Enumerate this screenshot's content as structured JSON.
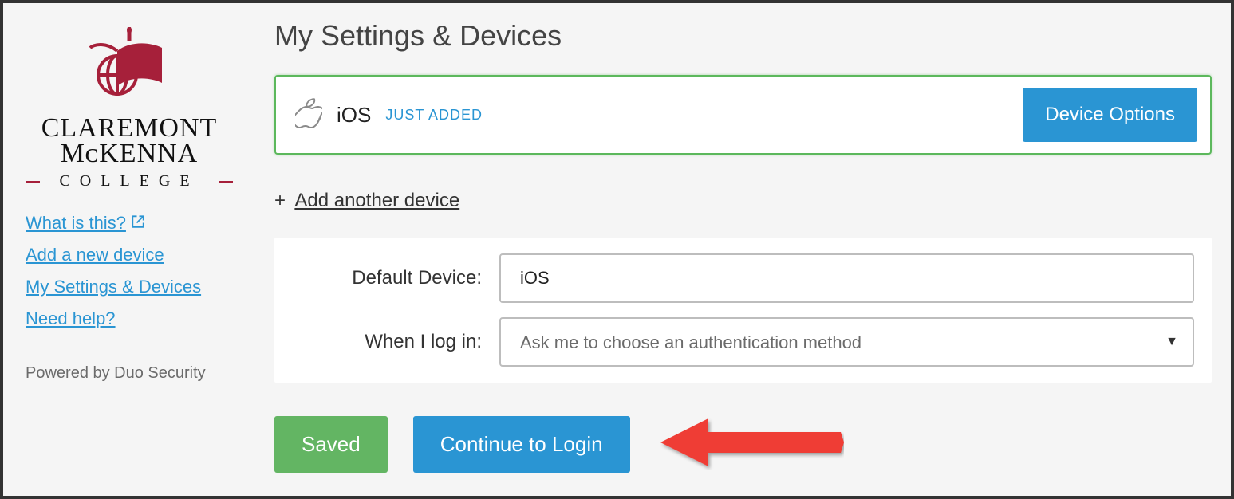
{
  "logo": {
    "line1": "CLAREMONT",
    "line2": "MᴄKENNA",
    "line3": "COLLEGE"
  },
  "sidebar": {
    "links": {
      "what": "What is this?",
      "add": "Add a new device",
      "settings": "My Settings & Devices",
      "help": "Need help?"
    },
    "powered": "Powered by Duo Security"
  },
  "page": {
    "title": "My Settings & Devices"
  },
  "device": {
    "name": "iOS",
    "badge": "JUST ADDED",
    "options_label": "Device Options"
  },
  "add_device": {
    "plus": "+",
    "label": "Add another device"
  },
  "form": {
    "default_label": "Default Device:",
    "default_value": "iOS",
    "login_label": "When I log in:",
    "login_value": "Ask me to choose an authentication method"
  },
  "buttons": {
    "saved": "Saved",
    "continue": "Continue to Login"
  }
}
